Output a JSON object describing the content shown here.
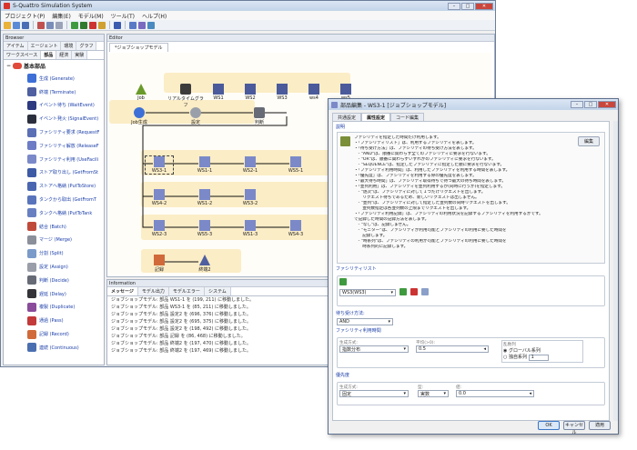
{
  "app": {
    "title": "S-Quattro Simulation System",
    "menu": [
      "プロジェクト(P)",
      "編集(E)",
      "モデル(M)",
      "ツール(T)",
      "ヘルプ(H)"
    ]
  },
  "browser": {
    "panel_title": "Browser",
    "tabs_row1": [
      "アイテム",
      "エージェント",
      "環境",
      "グラフ"
    ],
    "tabs_row2": [
      "ワークスペース",
      "部品",
      "経済",
      "実験"
    ],
    "root_label": "基本部品",
    "items": [
      {
        "label": "生成 (Generate)",
        "color": "#3d6fd6"
      },
      {
        "label": "終端 (Terminate)",
        "color": "#4f5fa0"
      },
      {
        "label": "イベント待ち (WaitEvent)",
        "color": "#2d3a80"
      },
      {
        "label": "イベント発火 (SignalEvent)",
        "color": "#2b2f3d"
      },
      {
        "label": "ファシリティ要求 (RequestF",
        "color": "#5b6fb5"
      },
      {
        "label": "ファシリティ解放 (ReleaseF",
        "color": "#6d7cc4"
      },
      {
        "label": "ファシリティ利用 (UseFacili",
        "color": "#7b89c9"
      },
      {
        "label": "ストア取り出し (GetFromSt",
        "color": "#3d5aa5"
      },
      {
        "label": "ストアへ格納 (PutToStore)",
        "color": "#4a66b0"
      },
      {
        "label": "タンクから取出 (GetFromT",
        "color": "#5a74bb"
      },
      {
        "label": "タンクへ格納 (PutToTank",
        "color": "#6880c2"
      },
      {
        "label": "結合 (Batch)",
        "color": "#c04a3a"
      },
      {
        "label": "マージ (Merge)",
        "color": "#8a8f99"
      },
      {
        "label": "分割 (Split)",
        "color": "#7a9ac9"
      },
      {
        "label": "設定 (Assign)",
        "color": "#9a9ea8"
      },
      {
        "label": "判断 (Decide)",
        "color": "#666b76"
      },
      {
        "label": "遅延 (Delay)",
        "color": "#333338"
      },
      {
        "label": "複製 (Duplicate)",
        "color": "#8a4b9a"
      },
      {
        "label": "通過 (Pass)",
        "color": "#c23a3a"
      },
      {
        "label": "記録 (Record)",
        "color": "#d06a3a"
      },
      {
        "label": "連続 (Continuous)",
        "color": "#4a6fb0"
      }
    ]
  },
  "editor": {
    "panel_title": "Editor",
    "tab": "*ジョブショップモデル",
    "nodes": {
      "job": "Job",
      "realtime_graph": "リアルタイムグラフ",
      "ws1_top": "WS1",
      "ws2_top": "WS2",
      "ws3_top": "WS3",
      "ws4_top": "ws4",
      "ws5_top": "ws5",
      "job_gen": "Job生成",
      "setting": "設定",
      "decide": "判断",
      "ws3_1": "WS3-1",
      "ws1_1": "WS1-1",
      "ws2_1": "WS2-1",
      "ws5_1": "WS5-1",
      "ws4_2": "WS4-2",
      "ws1_2": "WS1-2",
      "ws3_2": "WS3-2",
      "ws2_3": "WS2-3",
      "ws5_3": "WS5-3",
      "ws1_3": "WS1-3",
      "ws4_3": "WS4-3",
      "record": "記録",
      "end2": "終端2"
    }
  },
  "info": {
    "panel_title": "Information",
    "tabs": [
      "メッセージ",
      "モデル出力",
      "モデルエラー",
      "システム"
    ],
    "lines": [
      "ジョブショップモデル: 部品 WS1-1 を (199, 211) に移動しました。",
      "ジョブショップモデル: 部品 WS3-1 を (85, 211) に移動しました。",
      "ジョブショップモデル: 部品 設定2 を (696, 376) に移動しました。",
      "ジョブショップモデル: 部品 設定2 を (695, 375) に移動しました。",
      "ジョブショップモデル: 部品 設定2 を (198, 492) に移動しました。",
      "ジョブショップモデル: 部品 記録 を (86, 468) に移動しました。",
      "ジョブショップモデル: 部品 終端2 を (197, 470) に移動しました。",
      "ジョブショップモデル: 部品 終端2 を (197, 469) に移動しました。"
    ]
  },
  "dialog": {
    "title": "部品編集 - WS3-1 [ジョブショップモデル]",
    "tabs": [
      "共通設定",
      "属性設定",
      "コード編集"
    ],
    "description_label": "説明",
    "edit_button": "編集",
    "description_lines": [
      "ファシリティを指定した時間だけ利用します。",
      "・「ファシリティリスト」は、利用するファシリティを表します。",
      "・「待ち受け方法」は、ファシリティの待ち受け方法を表します。",
      "　- \"AND\"は、順番に関わらず全てのファシリティに要求を行ないます。",
      "　- \"OR\"は、順番に関わらずいずれかのファシリティに要求を行ないます。",
      "　- \"SEQUENCE\"は、指定したファシリティに指定した順に要求を行ないます。",
      "・「ファシリティ利用時間」は、利用したファシリティを利用する時間を表します。",
      "・「優先度」は、ファシリティを利用する際の優先度を表します。",
      "・「最大待ち時間」は、ファシリティ取得待ちで待つ最大の待ち時間を表します。",
      "・「並列利用」は、ファシリティを並列利用するか(同時に行うか)を指定します。",
      "　- \"逐次\"は、ファシリティに対して１つだけリクエストを出します。",
      "　　リクエスト待ちであるため、新しいリクエストは出しません。",
      "　- \"並列\"は、ファシリティに対して指定した並列数の同時リクエストを出します。",
      "　　並列数指定は各並列数の上限までリクエストを出します。",
      "・「ファシリティ利用記録」は、ファシリティの利用状況を記録するファシリティを利用するかです。",
      "で記録した時間の記録方法を表します。",
      "　- \"なし\"は、記録しません。",
      "　- \"モニター\"は、ファシリティが利用可能とファシリティの利用に要した時間を",
      "　　記録します。",
      "　- \"時系列\"は、ファシリティの利用が可能とファシリティの利用に要した時間を",
      "　　時系列的に記録します。"
    ],
    "facility_list_label": "ファシリティリスト",
    "facility_select": "WS3(WS3)",
    "wait_method_label": "待ち受け方法:",
    "wait_method_value": "AND",
    "usage_time_label": "ファシリティ利用時間",
    "gen_method_label": "生成方式:",
    "gen_method_value": "指数分布",
    "mean_label": "平均(>0):",
    "mean_value": "0.5",
    "random_label": "乱数列",
    "radio_global": "グローバル系列",
    "radio_unique": "独自系列",
    "unique_value": "1",
    "priority_label": "優先度",
    "priority_gen_label": "生成方式:",
    "priority_gen_value": "固定",
    "type_label": "型:",
    "type_value": "実数",
    "value_label": "値:",
    "value_value": "0.0",
    "buttons": {
      "ok": "OK",
      "cancel": "キャンセル",
      "apply": "適用"
    }
  }
}
